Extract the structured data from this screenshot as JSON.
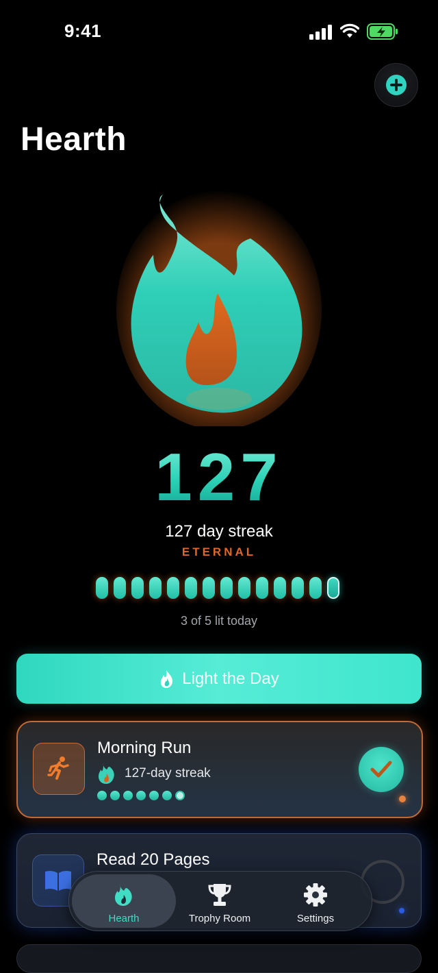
{
  "status_bar": {
    "time": "9:41"
  },
  "header": {
    "title": "Hearth",
    "add_icon": "plus-icon"
  },
  "hero": {
    "streak_number": "127",
    "streak_label": "127 day streak",
    "tier": "ETERNAL",
    "lit_today": "3 of 5 lit today",
    "day_pills": {
      "lit": 13,
      "current": 1
    }
  },
  "primary_action": {
    "label": "Light the Day",
    "icon": "flame-icon"
  },
  "habits": [
    {
      "name": "Morning Run",
      "icon": "running-person-icon",
      "streak": "127-day streak",
      "dots_filled": 6,
      "dots_open": 1,
      "completed": true
    },
    {
      "name": "Read 20 Pages",
      "icon": "book-icon",
      "completed": false
    }
  ],
  "tab_bar": {
    "tabs": [
      {
        "label": "Hearth",
        "icon": "flame-icon",
        "active": true
      },
      {
        "label": "Trophy Room",
        "icon": "trophy-icon",
        "active": false
      },
      {
        "label": "Settings",
        "icon": "gear-icon",
        "active": false
      }
    ]
  },
  "colors": {
    "accent": "#2fd3bf",
    "flame_core": "#d8631f",
    "tier": "#e0672a"
  }
}
